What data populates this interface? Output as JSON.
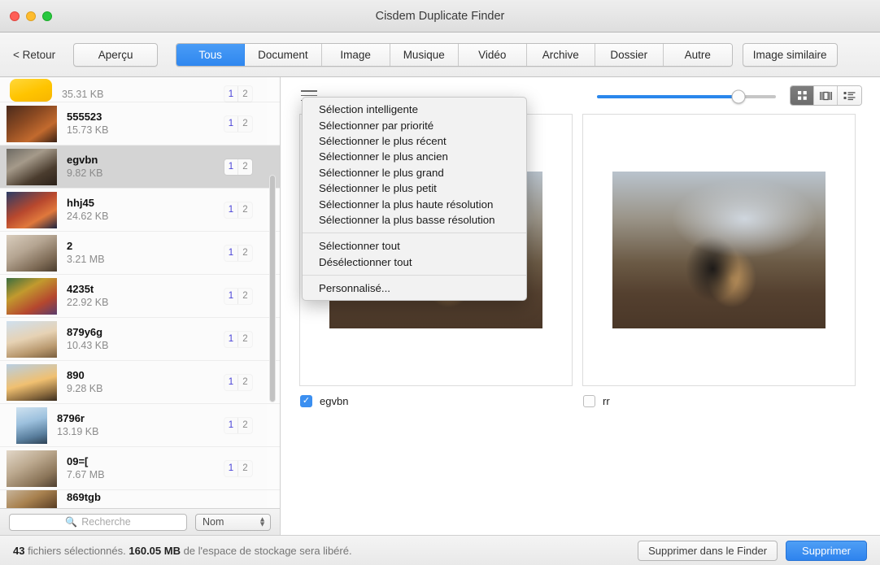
{
  "window": {
    "title": "Cisdem Duplicate Finder",
    "traffic_lights": [
      "close-button",
      "minimize-button",
      "zoom-button"
    ]
  },
  "toolbar": {
    "back_label": "< Retour",
    "preview_label": "Aperçu",
    "tabs": [
      {
        "label": "Tous",
        "active": true
      },
      {
        "label": "Document",
        "active": false
      },
      {
        "label": "Image",
        "active": false
      },
      {
        "label": "Musique",
        "active": false
      },
      {
        "label": "Vidéo",
        "active": false
      },
      {
        "label": "Archive",
        "active": false
      },
      {
        "label": "Dossier",
        "active": false
      },
      {
        "label": "Autre",
        "active": false
      }
    ],
    "similar_image_label": "Image similaire",
    "accent_color": "#2f87ef"
  },
  "sidebar": {
    "files": [
      {
        "name": "",
        "size": "35.31 KB",
        "count_a": "1",
        "count_b": "2",
        "selected": false,
        "partial": "top"
      },
      {
        "name": "555523",
        "size": "15.73 KB",
        "count_a": "1",
        "count_b": "2",
        "selected": false
      },
      {
        "name": "egvbn",
        "size": "9.82 KB",
        "count_a": "1",
        "count_b": "2",
        "selected": true
      },
      {
        "name": "hhj45",
        "size": "24.62 KB",
        "count_a": "1",
        "count_b": "2",
        "selected": false
      },
      {
        "name": "2",
        "size": "3.21 MB",
        "count_a": "1",
        "count_b": "2",
        "selected": false
      },
      {
        "name": "4235t",
        "size": "22.92 KB",
        "count_a": "1",
        "count_b": "2",
        "selected": false
      },
      {
        "name": "879y6g",
        "size": "10.43 KB",
        "count_a": "1",
        "count_b": "2",
        "selected": false
      },
      {
        "name": "890",
        "size": "9.28 KB",
        "count_a": "1",
        "count_b": "2",
        "selected": false
      },
      {
        "name": "8796r",
        "size": "13.19 KB",
        "count_a": "1",
        "count_b": "2",
        "selected": false
      },
      {
        "name": "09=[",
        "size": "7.67 MB",
        "count_a": "1",
        "count_b": "2",
        "selected": false
      },
      {
        "name": "869tgb",
        "size": "",
        "count_a": "",
        "count_b": "",
        "selected": false,
        "partial": "bottom"
      }
    ],
    "search": {
      "placeholder": "Recherche",
      "value": "",
      "icon": "search-icon"
    },
    "sort": {
      "selected": "Nom",
      "options": [
        "Nom"
      ]
    }
  },
  "content": {
    "menu_icon": "hamburger-menu-icon",
    "zoom_slider": {
      "value": 79,
      "min": 0,
      "max": 100
    },
    "view_modes": [
      {
        "name": "grid-view",
        "icon": "grid-icon",
        "active": true
      },
      {
        "name": "coverflow-view",
        "icon": "coverflow-icon",
        "active": false
      },
      {
        "name": "list-view",
        "icon": "list-icon",
        "active": false
      }
    ],
    "panels": [
      {
        "caption": "egvbn",
        "checked": true
      },
      {
        "caption": "rr",
        "checked": false
      }
    ]
  },
  "context_menu": {
    "groups": [
      {
        "items": [
          "Sélection intelligente",
          "Sélectionner par priorité",
          "Sélectionner le plus récent",
          "Sélectionner le plus ancien",
          "Sélectionner le plus grand",
          "Sélectionner le plus petit",
          "Sélectionner la plus haute résolution",
          "Sélectionner la plus basse résolution"
        ]
      },
      {
        "items": [
          "Sélectionner tout",
          "Désélectionner tout"
        ]
      },
      {
        "items": [
          "Personnalisé..."
        ]
      }
    ]
  },
  "bottom": {
    "status_count": "43",
    "status_mid": " fichiers sélectionnés. ",
    "status_size": "160.05 MB",
    "status_tail": " de l'espace de stockage sera libéré.",
    "finder_label": "Supprimer dans le Finder",
    "delete_label": "Supprimer",
    "delete_color": "#2e83ee"
  }
}
